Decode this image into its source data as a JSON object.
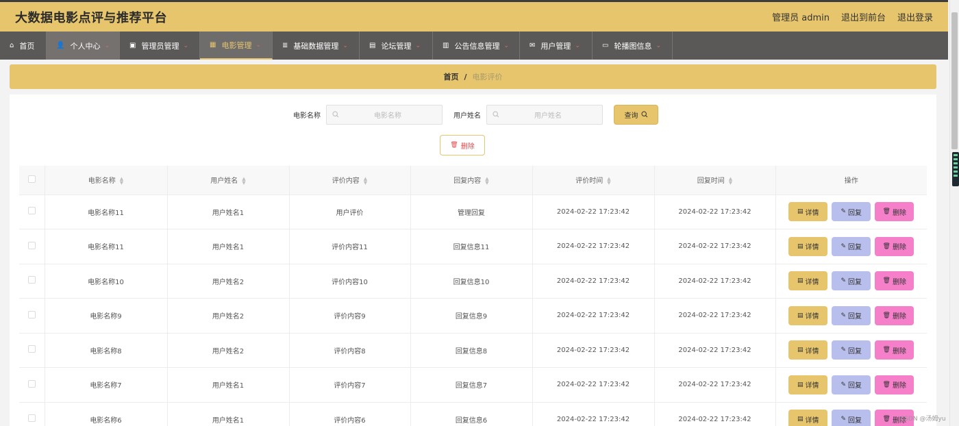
{
  "header": {
    "title": "大数据电影点评与推荐平台",
    "admin_label": "管理员 admin",
    "back_front_label": "退出到前台",
    "logout_label": "退出登录"
  },
  "nav": {
    "items": [
      {
        "label": "首页",
        "icon": "home-icon",
        "caret": false
      },
      {
        "label": "个人中心",
        "icon": "user-icon",
        "caret": true
      },
      {
        "label": "管理员管理",
        "icon": "briefcase-icon",
        "caret": true
      },
      {
        "label": "电影管理",
        "icon": "grid-icon",
        "caret": true
      },
      {
        "label": "基础数据管理",
        "icon": "list-icon",
        "caret": true
      },
      {
        "label": "论坛管理",
        "icon": "forum-icon",
        "caret": true
      },
      {
        "label": "公告信息管理",
        "icon": "notice-icon",
        "caret": true
      },
      {
        "label": "用户管理",
        "icon": "mail-icon",
        "caret": true
      },
      {
        "label": "轮播图信息",
        "icon": "chat-icon",
        "caret": true
      }
    ]
  },
  "breadcrumb": {
    "home": "首页",
    "separator": "/",
    "current": "电影评价"
  },
  "search": {
    "movie_label": "电影名称",
    "movie_placeholder": "电影名称",
    "user_label": "用户姓名",
    "user_placeholder": "用户姓名",
    "query_label": "查询"
  },
  "batch_delete_label": "删除",
  "table": {
    "columns": [
      "电影名称",
      "用户姓名",
      "评价内容",
      "回复内容",
      "评价时间",
      "回复时间",
      "操作"
    ],
    "rows": [
      {
        "movie": "电影名称11",
        "user": "用户姓名1",
        "review": "用户评价",
        "reply": "管理回复",
        "review_time": "2024-02-22 17:23:42",
        "reply_time": "2024-02-22 17:23:42"
      },
      {
        "movie": "电影名称11",
        "user": "用户姓名1",
        "review": "评价内容11",
        "reply": "回复信息11",
        "review_time": "2024-02-22 17:23:42",
        "reply_time": "2024-02-22 17:23:42"
      },
      {
        "movie": "电影名称10",
        "user": "用户姓名2",
        "review": "评价内容10",
        "reply": "回复信息10",
        "review_time": "2024-02-22 17:23:42",
        "reply_time": "2024-02-22 17:23:42"
      },
      {
        "movie": "电影名称9",
        "user": "用户姓名2",
        "review": "评价内容9",
        "reply": "回复信息9",
        "review_time": "2024-02-22 17:23:42",
        "reply_time": "2024-02-22 17:23:42"
      },
      {
        "movie": "电影名称8",
        "user": "用户姓名2",
        "review": "评价内容8",
        "reply": "回复信息8",
        "review_time": "2024-02-22 17:23:42",
        "reply_time": "2024-02-22 17:23:42"
      },
      {
        "movie": "电影名称7",
        "user": "用户姓名1",
        "review": "评价内容7",
        "reply": "回复信息7",
        "review_time": "2024-02-22 17:23:42",
        "reply_time": "2024-02-22 17:23:42"
      },
      {
        "movie": "电影名称6",
        "user": "用户姓名1",
        "review": "评价内容6",
        "reply": "回复信息6",
        "review_time": "2024-02-22 17:23:42",
        "reply_time": "2024-02-22 17:23:42"
      }
    ],
    "actions": {
      "detail": "详情",
      "reply": "回复",
      "delete": "删除"
    }
  },
  "colors": {
    "accent": "#e6c56c",
    "nav_bg": "#5b5958",
    "reply_btn": "#b9bfec",
    "delete_btn": "#f57fc9"
  },
  "watermark": "CSDN @汤姆yu"
}
